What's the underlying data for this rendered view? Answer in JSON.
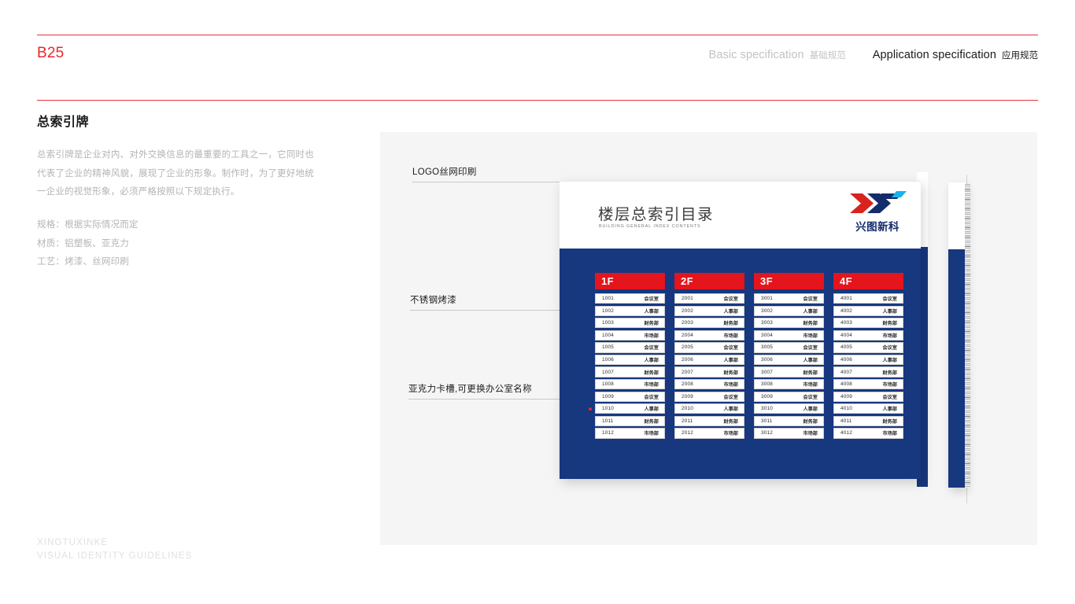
{
  "header": {
    "page_code": "B25",
    "rule_color": "#e2353c",
    "basic_en": "Basic specification",
    "basic_cn": "基础规范",
    "app_en": "Application specification",
    "app_cn": "应用规范"
  },
  "left": {
    "section_title": "总索引牌",
    "body": "总索引牌是企业对内、对外交换信息的最重要的工具之一，它同时也代表了企业的精神风貌，展现了企业的形象。制作时，为了更好地统一企业的视觉形象，必须严格按照以下规定执行。",
    "spec_size": "规格：根据实际情况而定",
    "spec_material": "材质：铝塑板、亚克力",
    "spec_process": "工艺：烤漆、丝网印刷",
    "footer_line1": "XINGTUXINKE",
    "footer_line2": "VISUAL IDENTITY GUIDELINES"
  },
  "callouts": [
    {
      "label": "LOGO丝网印刷"
    },
    {
      "label": "不锈钢烤漆"
    },
    {
      "label": "亚克力卡槽,可更换办公室名称"
    }
  ],
  "board": {
    "title_cn": "楼层总索引目录",
    "title_en": "BUILDING GENERAL INDEX CONTENTS",
    "logo_text": "兴图新科",
    "logo_mark": "XT",
    "colors": {
      "navy": "#17377f",
      "red": "#e4151c",
      "cyan": "#00a5e3",
      "logo_red": "#d9231f",
      "logo_navy": "#132c6b"
    },
    "columns": [
      {
        "floor": "1F",
        "rows": [
          {
            "no": "1001",
            "name": "会议室"
          },
          {
            "no": "1002",
            "name": "人事部"
          },
          {
            "no": "1003",
            "name": "财务部"
          },
          {
            "no": "1004",
            "name": "市场部"
          },
          {
            "no": "1005",
            "name": "会议室"
          },
          {
            "no": "1006",
            "name": "人事部"
          },
          {
            "no": "1007",
            "name": "财务部"
          },
          {
            "no": "1008",
            "name": "市场部"
          },
          {
            "no": "1009",
            "name": "会议室"
          },
          {
            "no": "1010",
            "name": "人事部",
            "marked": true
          },
          {
            "no": "1011",
            "name": "财务部"
          },
          {
            "no": "1012",
            "name": "市场部"
          }
        ]
      },
      {
        "floor": "2F",
        "rows": [
          {
            "no": "2001",
            "name": "会议室"
          },
          {
            "no": "2002",
            "name": "人事部"
          },
          {
            "no": "2003",
            "name": "财务部"
          },
          {
            "no": "2004",
            "name": "市场部"
          },
          {
            "no": "2005",
            "name": "会议室"
          },
          {
            "no": "2006",
            "name": "人事部"
          },
          {
            "no": "2007",
            "name": "财务部"
          },
          {
            "no": "2008",
            "name": "市场部"
          },
          {
            "no": "2009",
            "name": "会议室"
          },
          {
            "no": "2010",
            "name": "人事部"
          },
          {
            "no": "2011",
            "name": "财务部"
          },
          {
            "no": "2012",
            "name": "市场部"
          }
        ]
      },
      {
        "floor": "3F",
        "rows": [
          {
            "no": "3001",
            "name": "会议室"
          },
          {
            "no": "3002",
            "name": "人事部"
          },
          {
            "no": "3003",
            "name": "财务部"
          },
          {
            "no": "3004",
            "name": "市场部"
          },
          {
            "no": "3005",
            "name": "会议室"
          },
          {
            "no": "3006",
            "name": "人事部"
          },
          {
            "no": "3007",
            "name": "财务部"
          },
          {
            "no": "3008",
            "name": "市场部"
          },
          {
            "no": "3009",
            "name": "会议室"
          },
          {
            "no": "3010",
            "name": "人事部"
          },
          {
            "no": "3011",
            "name": "财务部"
          },
          {
            "no": "3012",
            "name": "市场部"
          }
        ]
      },
      {
        "floor": "4F",
        "rows": [
          {
            "no": "4001",
            "name": "会议室"
          },
          {
            "no": "4002",
            "name": "人事部"
          },
          {
            "no": "4003",
            "name": "财务部"
          },
          {
            "no": "4004",
            "name": "市场部"
          },
          {
            "no": "4005",
            "name": "会议室"
          },
          {
            "no": "4006",
            "name": "人事部"
          },
          {
            "no": "4007",
            "name": "财务部"
          },
          {
            "no": "4008",
            "name": "市场部"
          },
          {
            "no": "4009",
            "name": "会议室"
          },
          {
            "no": "4010",
            "name": "人事部"
          },
          {
            "no": "4011",
            "name": "财务部"
          },
          {
            "no": "4012",
            "name": "市场部"
          }
        ]
      }
    ]
  }
}
